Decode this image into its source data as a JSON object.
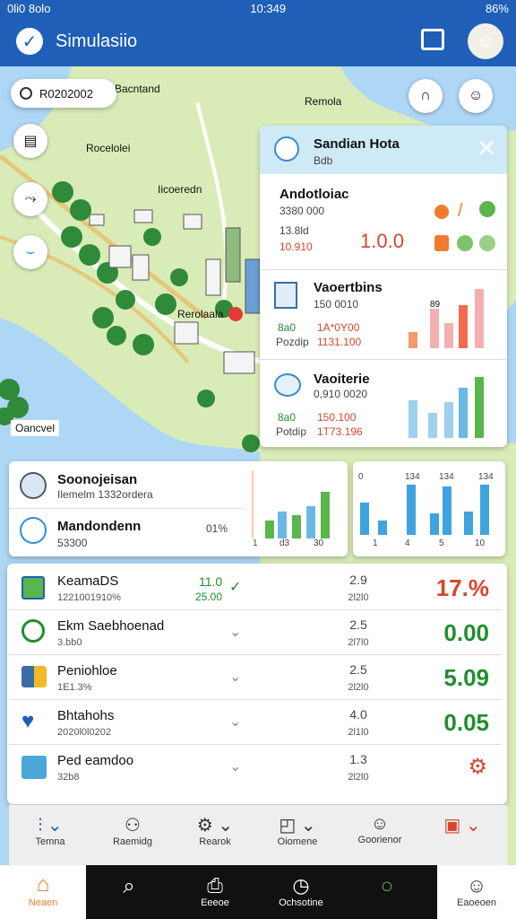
{
  "status": {
    "time": "10:349",
    "left": "0li0 8olo",
    "battery": "86%"
  },
  "app": {
    "title": "Simulasiio"
  },
  "search": {
    "value": "R0202002"
  },
  "map": {
    "labels": [
      "Bacntand",
      "Remola",
      "Rocelolei",
      "Iicoeredn",
      "Rerolaala",
      "Oancvel"
    ]
  },
  "popup": {
    "title": "Sandian Hota",
    "subtitle": "Bdb",
    "sec1": {
      "name": "Andotloiac",
      "v1": "3380 000",
      "v2": "13.8ld",
      "v3": "10.910",
      "big": "1.0.0"
    },
    "sec2": {
      "name": "Vaoertbins",
      "v1": "150 0010",
      "l1": "8a0",
      "l2": "Pozdip",
      "r1": "1A*0Y00",
      "r2": "1131.100",
      "ch": "89"
    },
    "sec3": {
      "name": "Vaoiterie",
      "v1": "0,910 0020",
      "l1": "8a0",
      "l2": "Potdip",
      "r1": "150.100",
      "r2": "1T73.196"
    }
  },
  "chartcard": {
    "r1name": "Soonojeisan",
    "r1sub": "Ilemelm 1332ordera",
    "r2name": "Mandondenn",
    "r2sub": "53300",
    "pct": "01%",
    "xticks": [
      "1",
      "d3",
      "30"
    ],
    "rticks": [
      "0",
      "134",
      "134",
      "134"
    ],
    "rxticks": [
      "1",
      "4",
      "5",
      "10"
    ]
  },
  "rows": [
    {
      "name": "KeamaDS",
      "meta": "1221001910%",
      "green1": "11.0",
      "green2": "25.00",
      "mid": "2.9",
      "mid2": "2l2l0",
      "big": "17.%",
      "color": "red"
    },
    {
      "name": "Ekm Saebhoenad",
      "meta": "3.bb0",
      "mid": "2.5",
      "mid2": "2l7l0",
      "big": "0.00",
      "color": "green"
    },
    {
      "name": "Peniohloe",
      "meta": "1E1.3%",
      "mid": "2.5",
      "mid2": "2l2l0",
      "big": "5.09",
      "color": "green"
    },
    {
      "name": "Bhtahohs",
      "meta": "2020l0l0202",
      "mid": "4.0",
      "mid2": "2l1l0",
      "big": "0.05",
      "color": "green"
    },
    {
      "name": "Ped eamdoo",
      "meta": "32b8",
      "mid": "1.3",
      "mid2": "2l2l0",
      "big": "",
      "color": "red"
    }
  ],
  "nav": [
    "Temna",
    "Raemidg",
    "Rearok",
    "Oiomene",
    "Goorienor",
    ""
  ],
  "bottom": [
    "Neaen",
    "",
    "Eeeoe",
    "Ochsotine",
    "",
    "Eaoeoen"
  ],
  "colors": {
    "accent": "#1f5fb8",
    "green": "#1f8f2e",
    "red": "#d9452b"
  }
}
